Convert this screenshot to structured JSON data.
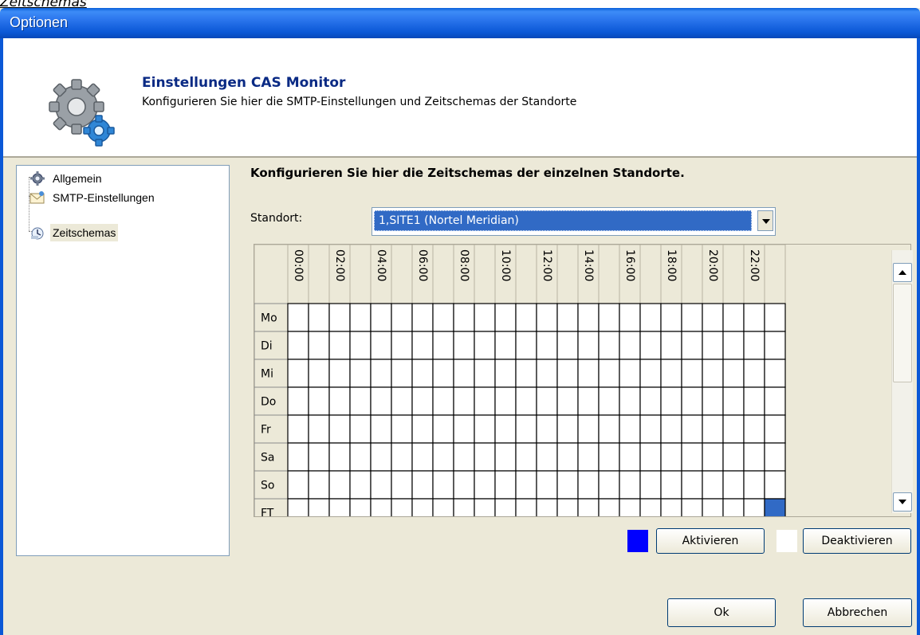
{
  "caption": "Zeitschemas",
  "window": {
    "title": "Optionen"
  },
  "header": {
    "icon": "gears-icon",
    "title": "Einstellungen CAS Monitor",
    "subtitle": "Konfigurieren Sie hier die SMTP-Einstellungen und Zeitschemas der Standorte"
  },
  "tree": {
    "items": [
      {
        "label": "Allgemein",
        "icon": "gear-icon",
        "selected": false
      },
      {
        "label": "SMTP-Einstellungen",
        "icon": "mail-icon",
        "selected": false
      },
      {
        "label": "Zeitschemas",
        "icon": "clock-icon",
        "selected": true
      }
    ]
  },
  "panel": {
    "title": "Konfigurieren Sie hier die Zeitschemas der einzelnen Standorte.",
    "standort_label": "Standort:",
    "standort_value": "1,SITE1 (Nortel Meridian)"
  },
  "schedule": {
    "hour_labels": [
      "00:00",
      "02:00",
      "04:00",
      "06:00",
      "08:00",
      "10:00",
      "12:00",
      "14:00",
      "16:00",
      "18:00",
      "20:00",
      "22:00"
    ],
    "days": [
      "Mo",
      "Di",
      "Mi",
      "Do",
      "Fr",
      "Sa",
      "So",
      "FT"
    ],
    "active_cells": [
      {
        "day": "FT",
        "hour": 23
      }
    ],
    "active_color": "#316ac5"
  },
  "legend": {
    "active_color": "#0000ff",
    "inactive_color": "#ffffff",
    "activate_label": "Aktivieren",
    "deactivate_label": "Deaktivieren"
  },
  "buttons": {
    "ok_label": "Ok",
    "cancel_label": "Abbrechen"
  }
}
